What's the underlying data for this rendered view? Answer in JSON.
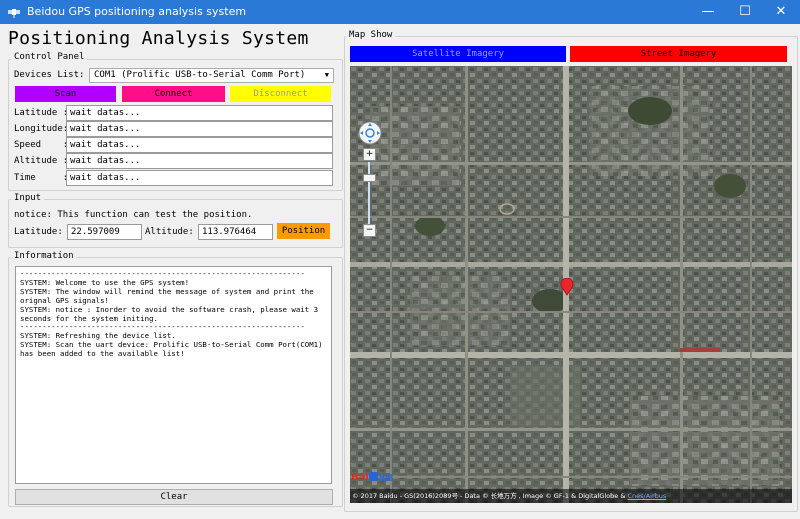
{
  "window": {
    "title": "Beidou GPS positioning analysis system",
    "minimize": "—",
    "maximize": "☐",
    "close": "✕"
  },
  "heading": "Positioning Analysis System",
  "control_panel": {
    "title": "Control Panel",
    "devices_label": "Devices List:",
    "device_selected": "COM1 (Prolific USB-to-Serial Comm Port)",
    "buttons": {
      "scan": "Scan",
      "connect": "Connect",
      "disconnect": "Disconnect"
    },
    "fields": [
      {
        "label": "Latitude :",
        "value": "wait datas..."
      },
      {
        "label": "Longitude:",
        "value": "wait datas..."
      },
      {
        "label": "Speed    :",
        "value": "wait datas..."
      },
      {
        "label": "Altitude :",
        "value": "wait datas..."
      },
      {
        "label": "Time     :",
        "value": "wait datas..."
      }
    ]
  },
  "input_panel": {
    "title": "Input",
    "notice": "notice: This function can test the position.",
    "latitude_label": "Latitude:",
    "latitude_value": "22.597009",
    "altitude_label": "Altitude:",
    "altitude_value": "113.976464",
    "position_button": "Position"
  },
  "info_panel": {
    "title": "Information",
    "log": "----------------------------------------------------------------\nSYSTEM: Welcome to use the GPS system!\nSYSTEM: The window will remind the message of system and print the orignal GPS signals!\nSYSTEM: notice : Inorder to avoid the software crash, please wait 3 seconds for the system initing.\n----------------------------------------------------------------\nSYSTEM: Refreshing the device list.\nSYSTEM: Scan the uart device: Prolific USB-to-Serial Comm Port(COM1) has been added to the available list!",
    "clear_button": "Clear"
  },
  "map": {
    "title": "Map Show",
    "tab_satellite": "Satellite Imagery",
    "tab_street": "Street Imagery",
    "zoom_in": "+",
    "zoom_out": "−",
    "logo_text": "Bai",
    "logo_icon": "paw-icon",
    "logo_cn": "地图",
    "copyright": "© 2017 Baidu - GS(2016)2089号 - Data © 长地万方 , Image © GF-1 & DigitalGlobe & ",
    "copyright_link": "Cnes/Airbus",
    "colors": {
      "satellite_tab": "#0000ff",
      "street_tab": "#ff0000",
      "marker": "#e8262b"
    }
  },
  "colors": {
    "titlebar": "#2b79d7",
    "scan": "#b000ff",
    "connect": "#ff0f87",
    "disconnect": "#ffff00",
    "position": "#ff9900"
  }
}
